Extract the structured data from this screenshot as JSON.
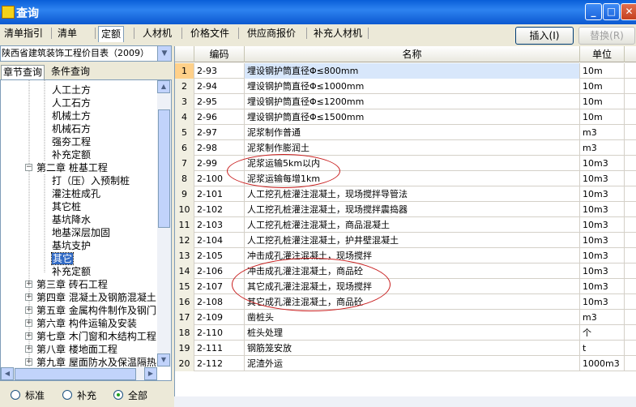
{
  "window": {
    "title": "查询",
    "min": "_",
    "max": "□",
    "close": "✕"
  },
  "tabs": [
    "清单指引",
    "清单",
    "定额",
    "人材机",
    "价格文件",
    "供应商报价",
    "补充人材机"
  ],
  "buttons": {
    "insert": "插入(I)",
    "replace": "替换(R)"
  },
  "library": {
    "selected": "陕西省建筑装饰工程价目表（2009）"
  },
  "subtabs": [
    "章节查询",
    "条件查询"
  ],
  "tree": [
    {
      "label": "人工土方",
      "level": 3
    },
    {
      "label": "人工石方",
      "level": 3
    },
    {
      "label": "机械土方",
      "level": 3
    },
    {
      "label": "机械石方",
      "level": 3
    },
    {
      "label": "强夯工程",
      "level": 3
    },
    {
      "label": "补充定额",
      "level": 3
    },
    {
      "label": "第二章 桩基工程",
      "level": 2,
      "expander": "−"
    },
    {
      "label": "打（压）入预制桩",
      "level": 3
    },
    {
      "label": "灌注桩成孔",
      "level": 3
    },
    {
      "label": "其它桩",
      "level": 3
    },
    {
      "label": "基坑降水",
      "level": 3
    },
    {
      "label": "地基深层加固",
      "level": 3
    },
    {
      "label": "基坑支护",
      "level": 3
    },
    {
      "label": "其它",
      "level": 3,
      "selected": true
    },
    {
      "label": "补充定额",
      "level": 3
    },
    {
      "label": "第三章 砖石工程",
      "level": 2,
      "expander": "+"
    },
    {
      "label": "第四章 混凝土及钢筋混凝土",
      "level": 2,
      "expander": "+"
    },
    {
      "label": "第五章 金属构件制作及钢门",
      "level": 2,
      "expander": "+"
    },
    {
      "label": "第六章 构件运输及安装",
      "level": 2,
      "expander": "+"
    },
    {
      "label": "第七章 木门窗和木结构工程",
      "level": 2,
      "expander": "+"
    },
    {
      "label": "第八章 楼地面工程",
      "level": 2,
      "expander": "+"
    },
    {
      "label": "第九章 屋面防水及保温隔热",
      "level": 2,
      "expander": "+"
    }
  ],
  "filters": [
    "标准",
    "补充",
    "全部"
  ],
  "filter_selected": "全部",
  "grid": {
    "columns": [
      "",
      "编码",
      "名称",
      "单位"
    ],
    "rows": [
      {
        "n": "1",
        "code": "2-93",
        "name": "埋设钢护筒直径Φ≤800mm",
        "unit": "10m"
      },
      {
        "n": "2",
        "code": "2-94",
        "name": "埋设钢护筒直径Φ≤1000mm",
        "unit": "10m"
      },
      {
        "n": "3",
        "code": "2-95",
        "name": "埋设钢护筒直径Φ≤1200mm",
        "unit": "10m"
      },
      {
        "n": "4",
        "code": "2-96",
        "name": "埋设钢护筒直径Φ≤1500mm",
        "unit": "10m"
      },
      {
        "n": "5",
        "code": "2-97",
        "name": "泥浆制作普通",
        "unit": "m3"
      },
      {
        "n": "6",
        "code": "2-98",
        "name": "泥浆制作膨润土",
        "unit": "m3"
      },
      {
        "n": "7",
        "code": "2-99",
        "name": "泥浆运输5km以内",
        "unit": "10m3"
      },
      {
        "n": "8",
        "code": "2-100",
        "name": "泥浆运输每增1km",
        "unit": "10m3"
      },
      {
        "n": "9",
        "code": "2-101",
        "name": "人工挖孔桩灌注混凝土，现场搅拌导管法",
        "unit": "10m3"
      },
      {
        "n": "10",
        "code": "2-102",
        "name": "人工挖孔桩灌注混凝土，现场搅拌震捣器",
        "unit": "10m3"
      },
      {
        "n": "11",
        "code": "2-103",
        "name": "人工挖孔桩灌注混凝土，商品混凝土",
        "unit": "10m3"
      },
      {
        "n": "12",
        "code": "2-104",
        "name": "人工挖孔桩灌注混凝土，护井壁混凝土",
        "unit": "10m3"
      },
      {
        "n": "13",
        "code": "2-105",
        "name": "冲击成孔灌注混凝土，现场搅拌",
        "unit": "10m3"
      },
      {
        "n": "14",
        "code": "2-106",
        "name": "冲击成孔灌注混凝土，商品砼",
        "unit": "10m3"
      },
      {
        "n": "15",
        "code": "2-107",
        "name": "其它成孔灌注混凝土，现场搅拌",
        "unit": "10m3"
      },
      {
        "n": "16",
        "code": "2-108",
        "name": "其它成孔灌注混凝土，商品砼",
        "unit": "10m3"
      },
      {
        "n": "17",
        "code": "2-109",
        "name": "凿桩头",
        "unit": "m3"
      },
      {
        "n": "18",
        "code": "2-110",
        "name": "桩头处理",
        "unit": "个"
      },
      {
        "n": "19",
        "code": "2-111",
        "name": "钢筋笼安放",
        "unit": "t"
      },
      {
        "n": "20",
        "code": "2-112",
        "name": "泥渣外运",
        "unit": "1000m3"
      }
    ]
  },
  "colors": {
    "titlebar": "#0a5fd8",
    "selected_row_header": "#ffd089",
    "annotation": "#c81e1e",
    "tree_selection": "#316ac5"
  }
}
